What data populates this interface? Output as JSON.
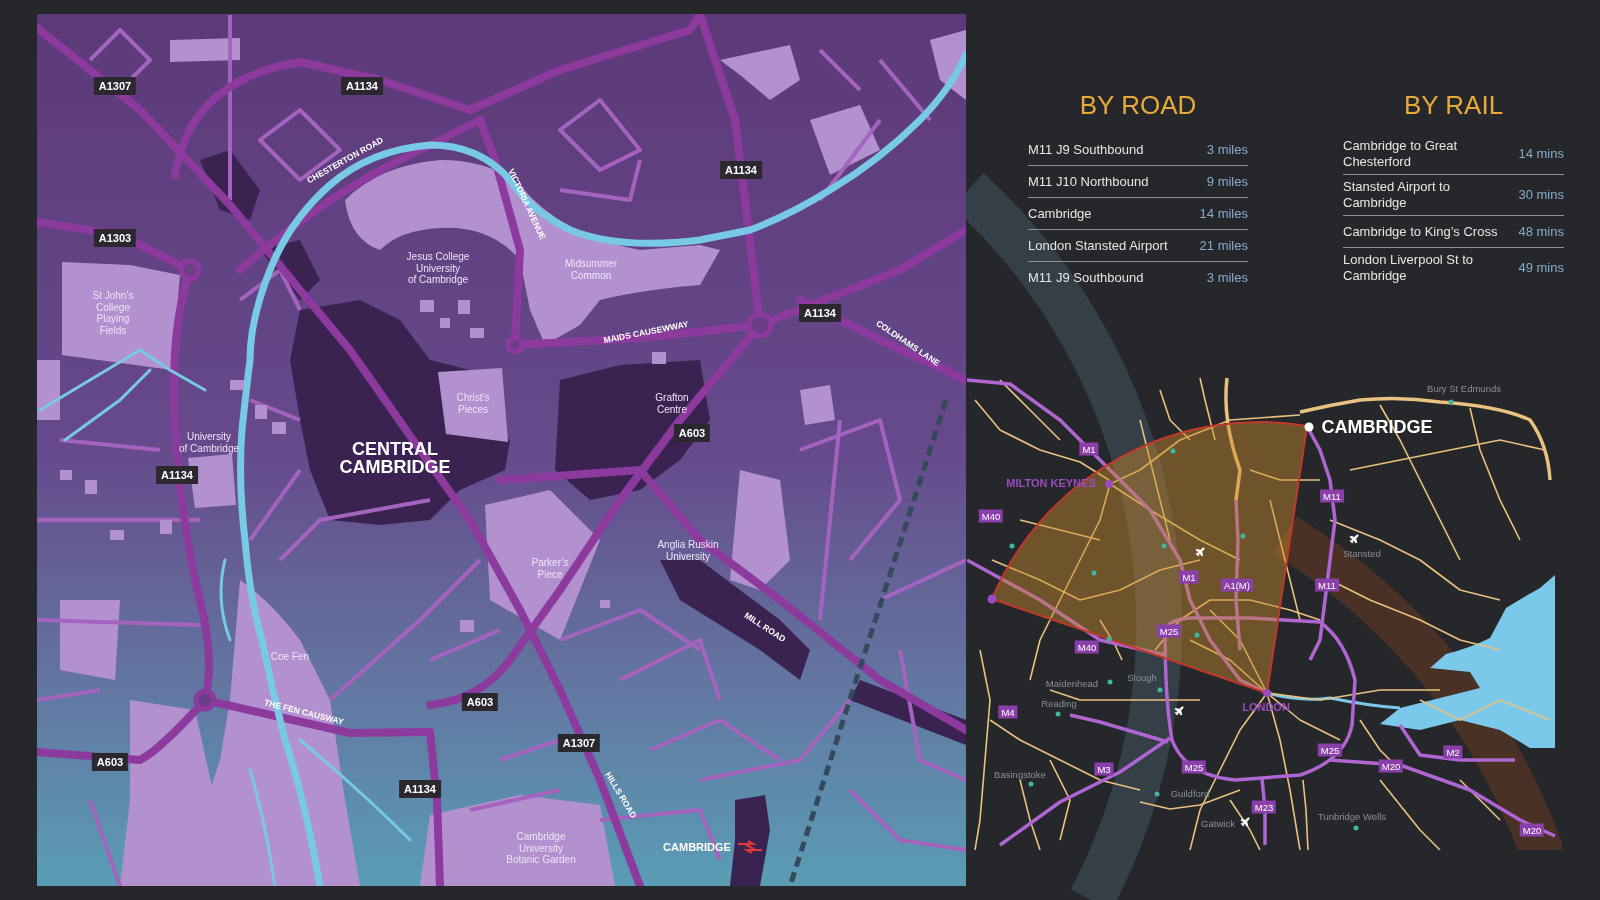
{
  "city_map": {
    "road_numbers": [
      "A1307",
      "A1134",
      "A1134",
      "A1303",
      "A1134",
      "A603",
      "A1134",
      "A603",
      "A1307",
      "A603",
      "A1134"
    ],
    "street_names": [
      "CHESTERTON ROAD",
      "VICTORIA AVENUE",
      "MAIDS CAUSEWWAY",
      "COLDHAMS LANE",
      "MILL ROAD",
      "THE FEN CAUSWAY",
      "HILLS ROAD"
    ],
    "places": [
      "Jesus College\nUniversity\nof Cambridge",
      "Midsummer\nCommon",
      "St John’s\nCollege\nPlaying\nFields",
      "Christ’s\nPieces",
      "Grafton\nCentre",
      "University\nof Cambridge",
      "Anglia Ruskin\nUniversity",
      "Parker’s\nPiece",
      "Coe Fen",
      "Cambridge\nUniversity\nBotanic Garden"
    ],
    "district": "CENTRAL\nCAMBRIDGE",
    "station": "CAMBRIDGE"
  },
  "by_road": {
    "title": "BY ROAD",
    "rows": [
      {
        "place": "M11 J9 Southbound",
        "distance": "3 miles"
      },
      {
        "place": "M11 J10 Northbound",
        "distance": "9 miles"
      },
      {
        "place": "Cambridge",
        "distance": "14 miles"
      },
      {
        "place": "London Stansted Airport",
        "distance": "21 miles"
      },
      {
        "place": "M11 J9 Southbound",
        "distance": "3 miles"
      }
    ]
  },
  "by_rail": {
    "title": "BY RAIL",
    "rows": [
      {
        "route": "Cambridge to Great\nChesterford",
        "time": "14 mins"
      },
      {
        "route": "Stansted Airport to\nCambridge",
        "time": "30 mins"
      },
      {
        "route": "Cambridge to King’s Cross",
        "time": "48 mins"
      },
      {
        "route": "London Liverpool St to\nCambridge",
        "time": "49 mins"
      }
    ]
  },
  "region_map": {
    "cities": [
      {
        "name": "CAMBRIDGE",
        "kind": "major"
      },
      {
        "name": "MILTON KEYNES",
        "kind": "hub"
      },
      {
        "name": "LONDON",
        "kind": "hub"
      }
    ],
    "towns": [
      "Bury St Edmunds",
      "Stansted",
      "Slough",
      "Maidenhead",
      "Reading",
      "Basingstoke",
      "Guildford",
      "Tunbridge Wells",
      "Gatwick"
    ],
    "motorways": [
      "M1",
      "M11",
      "M40",
      "M1",
      "A1(M)",
      "M11",
      "M25",
      "M40",
      "M4",
      "M25",
      "M2",
      "M3",
      "M25",
      "M20",
      "M23",
      "M20"
    ]
  }
}
